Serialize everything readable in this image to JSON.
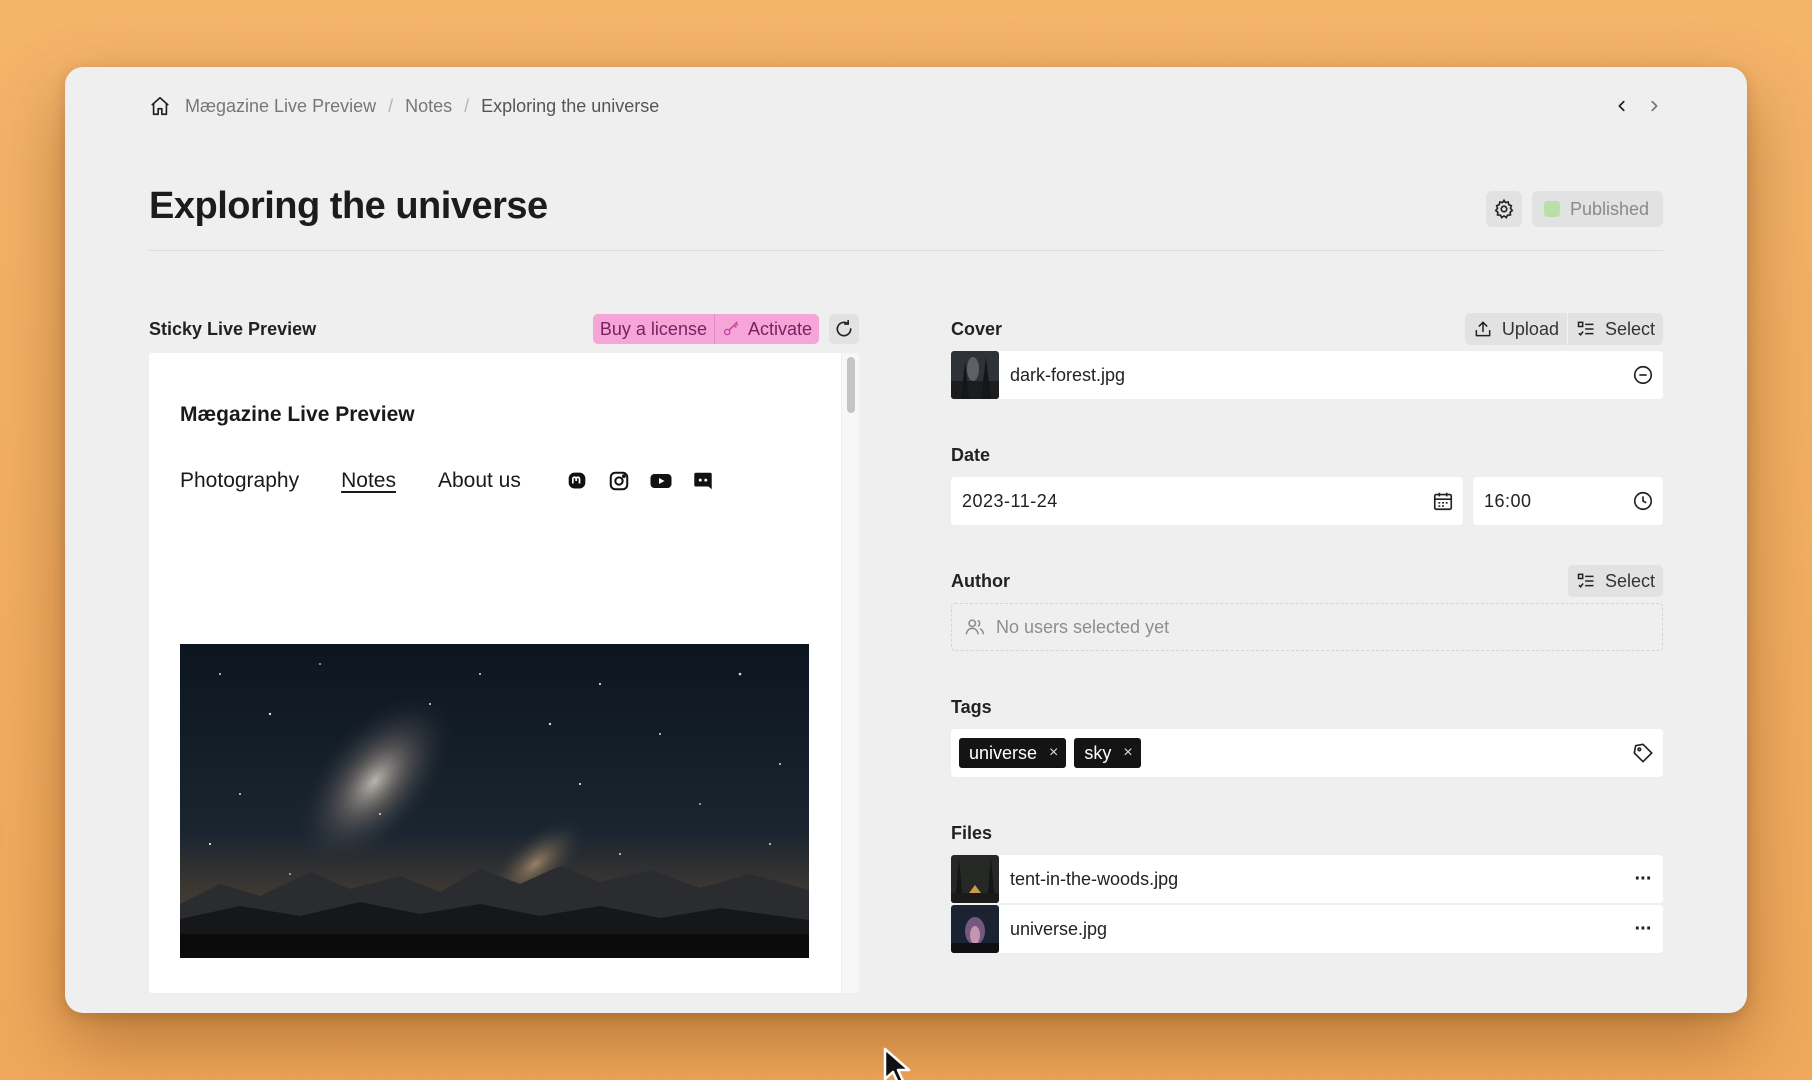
{
  "breadcrumb": {
    "items": [
      "Mægazine Live Preview",
      "Notes",
      "Exploring the universe"
    ],
    "separator": "/"
  },
  "page": {
    "title": "Exploring the universe",
    "status": "Published",
    "status_color": "#b8e0a8"
  },
  "preview": {
    "header": "Sticky Live Preview",
    "buy_license": "Buy a license",
    "activate": "Activate",
    "license_color": "#f6a5d8",
    "site_title": "Mægazine Live Preview",
    "nav": [
      {
        "label": "Photography",
        "active": false
      },
      {
        "label": "Notes",
        "active": true
      },
      {
        "label": "About us",
        "active": false
      }
    ],
    "social_icons": [
      "mastodon-icon",
      "instagram-icon",
      "youtube-icon",
      "discord-icon"
    ]
  },
  "cover": {
    "label": "Cover",
    "upload": "Upload",
    "select": "Select",
    "file": "dark-forest.jpg"
  },
  "date": {
    "label": "Date",
    "date_value": "2023-11-24",
    "time_value": "16:00"
  },
  "author": {
    "label": "Author",
    "select": "Select",
    "empty": "No users selected yet"
  },
  "tags": {
    "label": "Tags",
    "items": [
      "universe",
      "sky"
    ],
    "remove": "×"
  },
  "files": {
    "label": "Files",
    "items": [
      "tent-in-the-woods.jpg",
      "universe.jpg"
    ],
    "menu": "···"
  }
}
